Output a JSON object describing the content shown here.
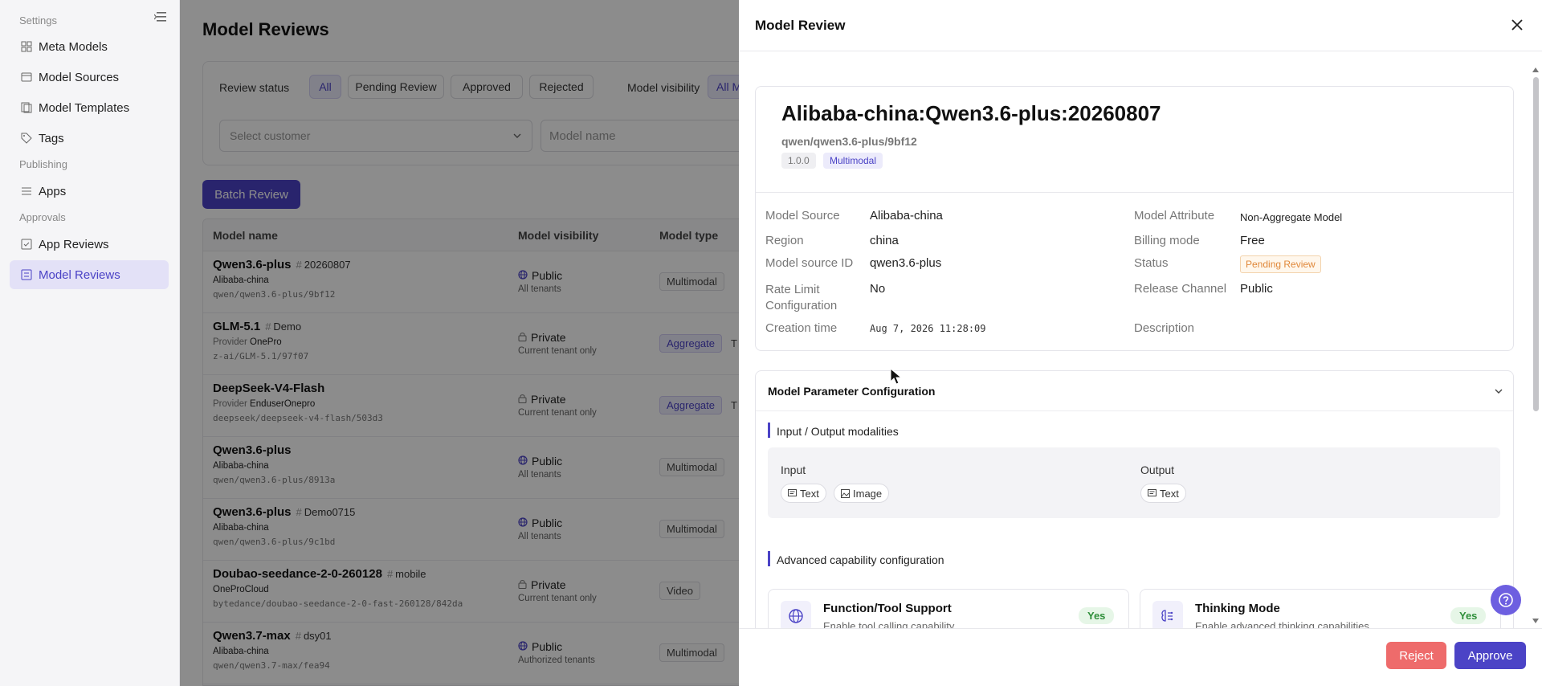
{
  "sidebar": {
    "section_settings": "Settings",
    "section_publishing": "Publishing",
    "section_approvals": "Approvals",
    "items": [
      {
        "label": "Meta Models",
        "icon": "meta-models-icon"
      },
      {
        "label": "Model Sources",
        "icon": "model-sources-icon"
      },
      {
        "label": "Model Templates",
        "icon": "model-templates-icon"
      },
      {
        "label": "Tags",
        "icon": "tag-icon"
      },
      {
        "label": "Apps",
        "icon": "apps-icon"
      },
      {
        "label": "App Reviews",
        "icon": "app-reviews-icon"
      },
      {
        "label": "Model Reviews",
        "icon": "model-reviews-icon",
        "active": true
      }
    ]
  },
  "main": {
    "title": "Model Reviews",
    "filters": {
      "review_status_label": "Review status",
      "status_options": [
        "All",
        "Pending Review",
        "Approved",
        "Rejected"
      ],
      "selected_status": "All",
      "visibility_label": "Model visibility",
      "visibility_selected": "All Mode",
      "customer_placeholder": "Select customer",
      "model_name_placeholder": "Model name"
    },
    "batch_button": "Batch Review",
    "table": {
      "columns": [
        "Model name",
        "Model visibility",
        "Model type"
      ],
      "rows": [
        {
          "name": "Qwen3.6-plus",
          "tag": "20260807",
          "sub_prefix": "",
          "sub": "Alibaba-china",
          "path": "qwen/qwen3.6-plus/9bf12",
          "visibility": "Public",
          "vis_sub": "All tenants",
          "type": "Multimodal",
          "extra": ""
        },
        {
          "name": "GLM-5.1",
          "tag": "Demo",
          "sub_prefix": "Provider",
          "sub": "OnePro",
          "path": "z-ai/GLM-5.1/97f07",
          "visibility": "Private",
          "vis_sub": "Current tenant only",
          "type": "Aggregate",
          "extra": "T"
        },
        {
          "name": "DeepSeek-V4-Flash",
          "tag": "",
          "sub_prefix": "Provider",
          "sub": "EnduserOnepro",
          "path": "deepseek/deepseek-v4-flash/503d3",
          "visibility": "Private",
          "vis_sub": "Current tenant only",
          "type": "Aggregate",
          "extra": "T"
        },
        {
          "name": "Qwen3.6-plus",
          "tag": "",
          "sub_prefix": "",
          "sub": "Alibaba-china",
          "path": "qwen/qwen3.6-plus/8913a",
          "visibility": "Public",
          "vis_sub": "All tenants",
          "type": "Multimodal",
          "extra": ""
        },
        {
          "name": "Qwen3.6-plus",
          "tag": "Demo0715",
          "sub_prefix": "",
          "sub": "Alibaba-china",
          "path": "qwen/qwen3.6-plus/9c1bd",
          "visibility": "Public",
          "vis_sub": "All tenants",
          "type": "Multimodal",
          "extra": ""
        },
        {
          "name": "Doubao-seedance-2-0-260128",
          "tag": "mobile",
          "sub_prefix": "",
          "sub": "OneProCloud",
          "path": "bytedance/doubao-seedance-2-0-fast-260128/842da",
          "visibility": "Private",
          "vis_sub": "Current tenant only",
          "type": "Video",
          "extra": ""
        },
        {
          "name": "Qwen3.7-max",
          "tag": "dsy01",
          "sub_prefix": "",
          "sub": "Alibaba-china",
          "path": "qwen/qwen3.7-max/fea94",
          "visibility": "Public",
          "vis_sub": "Authorized tenants",
          "type": "Multimodal",
          "extra": ""
        }
      ]
    }
  },
  "drawer": {
    "title": "Model Review",
    "model_title": "Alibaba-china:Qwen3.6-plus:20260807",
    "model_path": "qwen/qwen3.6-plus/9bf12",
    "version": "1.0.0",
    "category": "Multimodal",
    "details_left": [
      {
        "label": "Model Source",
        "value": "Alibaba-china"
      },
      {
        "label": "Region",
        "value": "china"
      },
      {
        "label": "Model source ID",
        "value": "qwen3.6-plus"
      },
      {
        "label": "Rate Limit Configuration",
        "value": "No"
      },
      {
        "label": "Creation time",
        "value": "Aug 7, 2026 11:28:09"
      }
    ],
    "details_right": [
      {
        "label": "Model Attribute",
        "value": "Non-Aggregate Model"
      },
      {
        "label": "Billing mode",
        "value": "Free"
      },
      {
        "label": "Status",
        "value": "Pending Review"
      },
      {
        "label": "Release Channel",
        "value": "Public"
      },
      {
        "label": "Description",
        "value": ""
      }
    ],
    "param_section": {
      "title": "Model Parameter Configuration",
      "io_title": "Input / Output modalities",
      "input_label": "Input",
      "output_label": "Output",
      "inputs": [
        "Text",
        "Image"
      ],
      "outputs": [
        "Text"
      ],
      "adv_title": "Advanced capability configuration",
      "capabilities": [
        {
          "title": "Function/Tool Support",
          "desc": "Enable tool calling capability",
          "value": "Yes",
          "icon": "globe-icon"
        },
        {
          "title": "Thinking Mode",
          "desc": "Enable advanced thinking capabilities",
          "value": "Yes",
          "icon": "brain-icon"
        }
      ]
    },
    "reject_label": "Reject",
    "approve_label": "Approve"
  },
  "colors": {
    "accent": "#4b43c6",
    "reject": "#ee6b6b",
    "pending": "#e0883a",
    "yes": "#2f8f3a"
  }
}
